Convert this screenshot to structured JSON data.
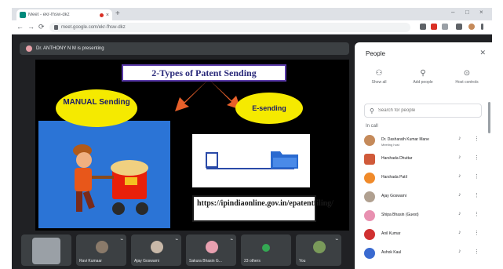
{
  "browser": {
    "tab_title": "Meet - ekr-fhsw-dkz",
    "url": "meet.google.com/ekr-fhsw-dkz",
    "new_tab_symbol": "+",
    "close_symbol": "×",
    "window_controls": [
      "–",
      "□",
      "×"
    ],
    "nav": {
      "back": "←",
      "forward": "→",
      "reload": "⟳"
    }
  },
  "meet": {
    "presenter_text": "Dr. ANTHONY N M is presenting"
  },
  "slide": {
    "title": "2-Types of Patent Sending",
    "manual_label": "MANUAL Sending",
    "esending_label": "E-sending",
    "url_text": "https://ipindiaonline.gov.in/epatentfiling/"
  },
  "tiles": [
    {
      "name": "",
      "color": "#9aa0a6"
    },
    {
      "name": "Ravi Kumaar",
      "color": "#8a7a6a"
    },
    {
      "name": "Ajay Goswami",
      "color": "#c8b8a8"
    },
    {
      "name": "Sakura Bhasin G...",
      "color": "#e8a0b0"
    },
    {
      "name": "23 others",
      "color": "#34a853"
    },
    {
      "name": "You",
      "color": "#7a9a5a"
    }
  ],
  "people_panel": {
    "title": "People",
    "close_icon": "close-icon",
    "actions": [
      {
        "label": "Show all",
        "icon": "people-icon"
      },
      {
        "label": "Add people",
        "icon": "add-person-icon"
      },
      {
        "label": "Host controls",
        "icon": "controls-icon"
      }
    ],
    "search_placeholder": "Search for people",
    "count_label": "In call",
    "participants": [
      {
        "name": "Dr. Dasharath Kumar Mane",
        "sub": "Meeting host",
        "color": "#c58a5a"
      },
      {
        "name": "Harshada Dhuttar",
        "sub": "",
        "color": "#d05a3a"
      },
      {
        "name": "Harshada Patil",
        "sub": "",
        "color": "#f08a2a"
      },
      {
        "name": "Ajay Goswami",
        "sub": "",
        "color": "#b0a090"
      },
      {
        "name": "Shipa Bhasin (Guest)",
        "sub": "",
        "color": "#e890b0"
      },
      {
        "name": "Anil Kumar",
        "sub": "",
        "color": "#d03030"
      },
      {
        "name": "Ashok Kaul",
        "sub": "",
        "color": "#3a6ad0"
      }
    ]
  }
}
